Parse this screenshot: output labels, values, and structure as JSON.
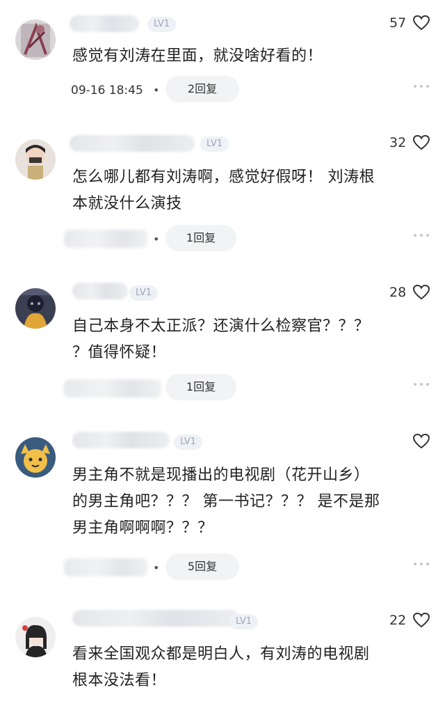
{
  "comments": [
    {
      "level": "LV1",
      "likes": "57",
      "text_lines": [
        "感觉有刘涛在里面，就没啥好看的！"
      ],
      "date": "09-16 18:45",
      "replies": "2回复"
    },
    {
      "level": "LV1",
      "likes": "32",
      "text_lines": [
        "怎么哪儿都有刘涛啊，感觉好假呀！ 刘涛根",
        "本就没什么演技"
      ],
      "replies": "1回复"
    },
    {
      "level": "LV1",
      "likes": "28",
      "text_lines": [
        "自己本身不太正派？还演什么检察官？？？",
        "？值得怀疑！"
      ],
      "replies": "1回复"
    },
    {
      "level": "LV1",
      "likes": "",
      "text_lines": [
        "男主角不就是现播出的电视剧（花开山乡）",
        "的男主角吧？？？ 第一书记？？？ 是不是那",
        "男主角啊啊啊？？？"
      ],
      "replies": "5回复"
    },
    {
      "level": "LV1",
      "likes": "22",
      "text_lines": [
        "看来全国观众都是明白人，有刘涛的电视剧",
        "根本没法看！"
      ]
    }
  ],
  "icons": {
    "like": "heart-outline-icon",
    "more": "more-dots-icon"
  },
  "colors": {
    "badge_bg": "#eef1f6",
    "badge_text": "#9aa6b8",
    "pill_bg": "#f2f3f5"
  }
}
